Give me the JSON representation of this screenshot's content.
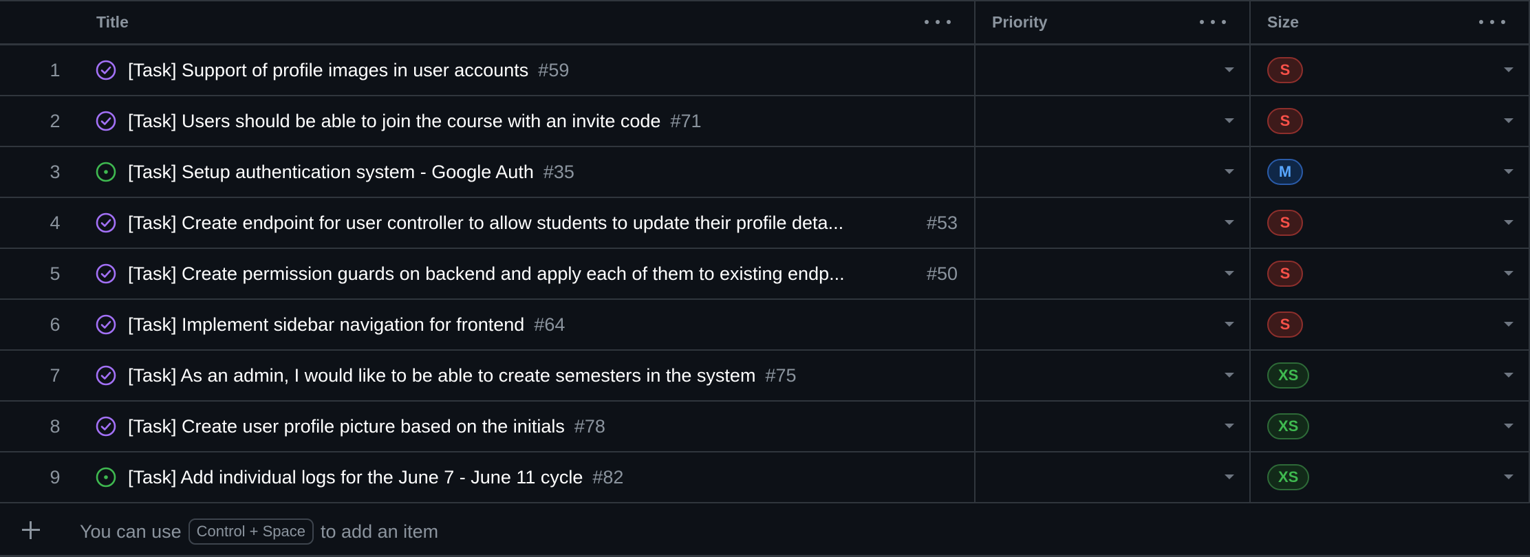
{
  "columns": {
    "title": "Title",
    "priority": "Priority",
    "size": "Size"
  },
  "status_colors": {
    "closed": "#a371f7",
    "open": "#3fb950"
  },
  "badge_styles": {
    "S": {
      "color": "#f85149",
      "bg": "#3d1a1a",
      "border": "#8e2f2c"
    },
    "M": {
      "color": "#58a6ff",
      "bg": "#0f2747",
      "border": "#2a5ba8"
    },
    "XS": {
      "color": "#3fb950",
      "bg": "#122a19",
      "border": "#2e6b38"
    }
  },
  "rows": [
    {
      "num": "1",
      "status": "closed",
      "status_icon": "issue-closed-icon",
      "title": "[Task] Support of profile images in user accounts",
      "issue": "#59",
      "priority": "",
      "size": "S"
    },
    {
      "num": "2",
      "status": "closed",
      "status_icon": "issue-closed-icon",
      "title": "[Task] Users should be able to join the course with an invite code",
      "issue": "#71",
      "priority": "",
      "size": "S"
    },
    {
      "num": "3",
      "status": "open",
      "status_icon": "issue-open-icon",
      "title": "[Task] Setup authentication system - Google Auth",
      "issue": "#35",
      "priority": "",
      "size": "M"
    },
    {
      "num": "4",
      "status": "closed",
      "status_icon": "issue-closed-icon",
      "title": "[Task] Create endpoint for user controller to allow students to update their profile deta...",
      "issue": "#53",
      "priority": "",
      "size": "S"
    },
    {
      "num": "5",
      "status": "closed",
      "status_icon": "issue-closed-icon",
      "title": "[Task] Create permission guards on backend and apply each of them to existing endp...",
      "issue": "#50",
      "priority": "",
      "size": "S"
    },
    {
      "num": "6",
      "status": "closed",
      "status_icon": "issue-closed-icon",
      "title": "[Task] Implement sidebar navigation for frontend",
      "issue": "#64",
      "priority": "",
      "size": "S"
    },
    {
      "num": "7",
      "status": "closed",
      "status_icon": "issue-closed-icon",
      "title": "[Task] As an admin, I would like to be able to create semesters in the system",
      "issue": "#75",
      "priority": "",
      "size": "XS"
    },
    {
      "num": "8",
      "status": "closed",
      "status_icon": "issue-closed-icon",
      "title": "[Task] Create user profile picture based on the initials",
      "issue": "#78",
      "priority": "",
      "size": "XS"
    },
    {
      "num": "9",
      "status": "open",
      "status_icon": "issue-open-icon",
      "title": "[Task] Add individual logs for the June 7 - June 11 cycle",
      "issue": "#82",
      "priority": "",
      "size": "XS"
    }
  ],
  "footer": {
    "prefix": "You can use",
    "shortcut": "Control + Space",
    "suffix": "to add an item"
  }
}
